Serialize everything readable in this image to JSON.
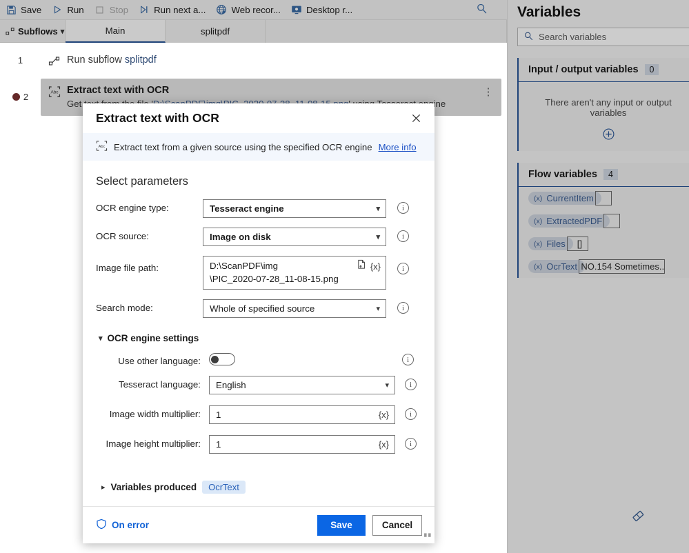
{
  "toolbar": {
    "items": [
      {
        "label": "Save",
        "icon": "save-icon",
        "disabled": false
      },
      {
        "label": "Run",
        "icon": "play-icon",
        "disabled": false
      },
      {
        "label": "Stop",
        "icon": "stop-icon",
        "disabled": true
      },
      {
        "label": "Run next a...",
        "icon": "step-over-icon",
        "disabled": false
      },
      {
        "label": "Web recor...",
        "icon": "globe-icon",
        "disabled": false
      },
      {
        "label": "Desktop r...",
        "icon": "monitor-icon",
        "disabled": false
      }
    ],
    "search_icon": "search-icon"
  },
  "tabstrip": {
    "subflows_label": "Subflows",
    "tabs": [
      {
        "label": "Main",
        "active": true
      },
      {
        "label": "splitpdf",
        "active": false
      }
    ]
  },
  "workspace": {
    "rows": [
      {
        "number": "1",
        "breakpoint": false,
        "icon": "subflow-icon",
        "title": "Run subflow",
        "title_link": "splitpdf",
        "subtitle": "",
        "selected": false
      },
      {
        "number": "2",
        "breakpoint": true,
        "icon": "ocr-icon",
        "title": "Extract text with OCR",
        "title_link": "",
        "subtitle_pre": "Get text from the file '",
        "subtitle_link": "D:\\ScanPDF\\img\\PIC_2020-07-28_11-08-15.png",
        "subtitle_post": "' using Tesseract engine",
        "selected": true
      }
    ]
  },
  "variables_pane": {
    "title": "Variables",
    "search_placeholder": "Search variables",
    "search_icon": "search-icon",
    "groups": [
      {
        "name": "Input / output variables",
        "count": "0",
        "empty_message": "There aren't any input or output variables",
        "add_icon": "plus-circle-icon",
        "items": []
      },
      {
        "name": "Flow variables",
        "count": "4",
        "items": [
          {
            "name": "CurrentItem",
            "value": ""
          },
          {
            "name": "ExtractedPDF",
            "value": ""
          },
          {
            "name": "Files",
            "value": "[]"
          },
          {
            "name": "OcrText",
            "value": "NO.154 Sometimes..."
          }
        ]
      }
    ],
    "eraser_icon": "eraser-icon"
  },
  "dialog": {
    "title": "Extract text with OCR",
    "close_icon": "close-icon",
    "desc_icon": "ocr-icon",
    "description": "Extract text from a given source using the specified OCR engine",
    "more_info_label": "More info",
    "section_title": "Select parameters",
    "fields": [
      {
        "label": "OCR engine type:",
        "type": "select",
        "value": "Tesseract engine",
        "bold": true
      },
      {
        "label": "OCR source:",
        "type": "select",
        "value": "Image on disk",
        "bold": true
      },
      {
        "label": "Image file path:",
        "type": "path",
        "value_line1": "D:\\ScanPDF\\img",
        "value_line2": "\\PIC_2020-07-28_11-08-15.png",
        "file_icon": "file-browse-icon",
        "var_icon": "{x}"
      },
      {
        "label": "Search mode:",
        "type": "select",
        "value": "Whole of specified source",
        "bold": false
      }
    ],
    "engine_settings": {
      "title": "OCR engine settings",
      "expanded": true,
      "chevron_icon": "chevron-down-icon",
      "fields": [
        {
          "label": "Use other language:",
          "type": "toggle",
          "value": "off"
        },
        {
          "label": "Tesseract language:",
          "type": "select",
          "value": "English"
        },
        {
          "label": "Image width multiplier:",
          "type": "text",
          "value": "1",
          "var_icon": "{x}"
        },
        {
          "label": "Image height multiplier:",
          "type": "text",
          "value": "1",
          "var_icon": "{x}"
        }
      ]
    },
    "variables_produced": {
      "label": "Variables produced",
      "chevron_icon": "chevron-right-icon",
      "pill": "OcrText"
    },
    "footer": {
      "on_error_label": "On error",
      "on_error_icon": "shield-icon",
      "save_label": "Save",
      "cancel_label": "Cancel"
    },
    "info_icon": "info-icon"
  },
  "colors": {
    "accent": "#0b66e4",
    "link": "#2a62b8",
    "breakpoint": "#a42727",
    "pill_bg": "#ccd6e6"
  }
}
